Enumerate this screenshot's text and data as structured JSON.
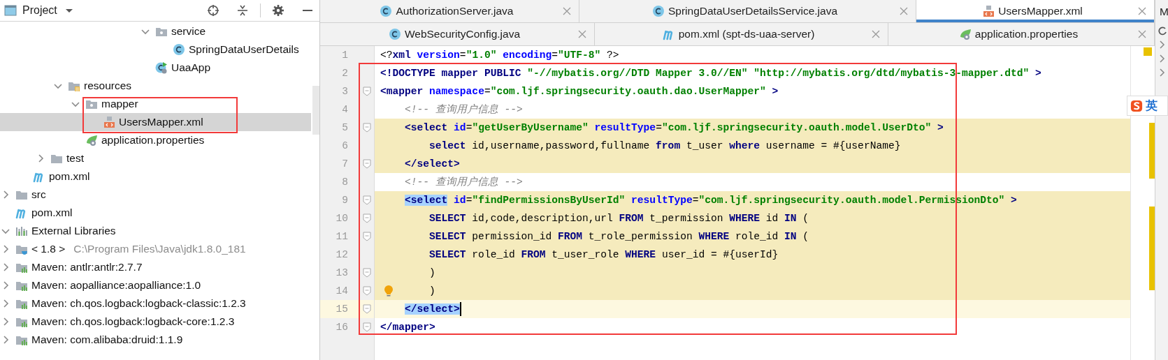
{
  "project_panel": {
    "title": "Project"
  },
  "tree": [
    {
      "children": [
        {
          "children": [
            {
              "children": [
                {
                  "children": [
                    {
                      "children": [
                        {
                          "children": [
                            {
                              "children": [
                                {
                                  "children": [
                                    {
                                      "children": [
                                        {
                                          "label": "service",
                                          "kind": "package",
                                          "expanded": true,
                                          "selected": false,
                                          "children": [
                                            {
                                              "label": "SpringDataUserDetails",
                                              "kind": "class",
                                              "selected": false
                                            }
                                          ]
                                        },
                                        {
                                          "label": "UaaApp",
                                          "kind": "boot-class",
                                          "selected": false
                                        }
                                      ]
                                    }
                                  ]
                                }
                              ]
                            }
                          ]
                        }
                      ]
                    },
                    {
                      "label": "resources",
                      "kind": "resources",
                      "expanded": true,
                      "selected": false,
                      "children": [
                        {
                          "label": "mapper",
                          "kind": "package",
                          "expanded": true,
                          "selected": false,
                          "children": [
                            {
                              "label": "UsersMapper.xml",
                              "kind": "xml",
                              "selected": true
                            }
                          ]
                        },
                        {
                          "label": "application.properties",
                          "kind": "properties",
                          "selected": false
                        }
                      ]
                    }
                  ]
                },
                {
                  "label": "test",
                  "kind": "folder",
                  "expanded": false,
                  "selected": false
                }
              ]
            },
            {
              "label": "pom.xml",
              "kind": "maven",
              "selected": false
            }
          ]
        },
        {
          "label": "src",
          "kind": "folder",
          "expanded": false,
          "selected": false
        },
        {
          "label": "pom.xml",
          "kind": "maven",
          "selected": false
        }
      ]
    },
    {
      "label": "External Libraries",
      "kind": "libraries",
      "expanded": true,
      "selected": false,
      "children": [
        {
          "label": "< 1.8 >",
          "secondary": "C:\\Program Files\\Java\\jdk1.8.0_181",
          "kind": "jdk",
          "expanded": false,
          "selected": false
        },
        {
          "label": "Maven: antlr:antlr:2.7.7",
          "kind": "library",
          "expanded": false,
          "selected": false
        },
        {
          "label": "Maven: aopalliance:aopalliance:1.0",
          "kind": "library",
          "expanded": false,
          "selected": false
        },
        {
          "label": "Maven: ch.qos.logback:logback-classic:1.2.3",
          "kind": "library",
          "expanded": false,
          "selected": false
        },
        {
          "label": "Maven: ch.qos.logback:logback-core:1.2.3",
          "kind": "library",
          "expanded": false,
          "selected": false
        },
        {
          "label": "Maven: com.alibaba:druid:1.1.9",
          "kind": "library",
          "expanded": false,
          "selected": false
        }
      ]
    }
  ],
  "tab_rows": [
    [
      {
        "label": "AuthorizationServer.java",
        "kind": "class",
        "selected": false
      },
      {
        "label": "SpringDataUserDetailsService.java",
        "kind": "class",
        "selected": false
      },
      {
        "label": "UsersMapper.xml",
        "kind": "xml",
        "selected": true
      }
    ],
    [
      {
        "label": "WebSecurityConfig.java",
        "kind": "class",
        "selected": false
      },
      {
        "label": "pom.xml (spt-ds-uaa-server)",
        "kind": "maven",
        "selected": false
      },
      {
        "label": "application.properties",
        "kind": "properties",
        "selected": false
      }
    ]
  ],
  "overflow_tab": {
    "label": "M"
  },
  "code_lines": [
    {
      "number": "1",
      "injected": false,
      "current": false,
      "fold": false,
      "bulb": false,
      "cursor": false,
      "tokens": [
        {
          "text": "<?",
          "kind": "plain"
        },
        {
          "text": "xml ",
          "kind": "tag"
        },
        {
          "text": "version",
          "kind": "attr"
        },
        {
          "text": "=",
          "kind": "plain"
        },
        {
          "text": "\"1.0\"",
          "kind": "string"
        },
        {
          "text": " encoding",
          "kind": "attr"
        },
        {
          "text": "=",
          "kind": "plain"
        },
        {
          "text": "\"UTF-8\"",
          "kind": "string"
        },
        {
          "text": " ?>",
          "kind": "plain"
        }
      ]
    },
    {
      "number": "2",
      "injected": false,
      "current": false,
      "fold": false,
      "bulb": false,
      "cursor": false,
      "tokens": [
        {
          "text": "<!DOCTYPE mapper PUBLIC ",
          "kind": "tag"
        },
        {
          "text": "\"-//mybatis.org//DTD Mapper 3.0//EN\" \"http://mybatis.org/dtd/mybatis-3-mapper.dtd\"",
          "kind": "string"
        },
        {
          "text": " >",
          "kind": "tag"
        }
      ]
    },
    {
      "number": "3",
      "injected": false,
      "current": false,
      "fold": true,
      "bulb": false,
      "cursor": false,
      "tokens": [
        {
          "text": "<mapper",
          "kind": "tag"
        },
        {
          "text": " namespace",
          "kind": "attr"
        },
        {
          "text": "=",
          "kind": "plain"
        },
        {
          "text": "\"com.ljf.springsecurity.oauth.dao.UserMapper\"",
          "kind": "string"
        },
        {
          "text": " >",
          "kind": "tag"
        }
      ]
    },
    {
      "number": "4",
      "injected": false,
      "current": false,
      "fold": false,
      "bulb": false,
      "cursor": false,
      "tokens": [
        {
          "text": "    <!-- 查询用户信息 -->",
          "kind": "comment"
        }
      ]
    },
    {
      "number": "5",
      "injected": true,
      "current": false,
      "fold": true,
      "bulb": false,
      "cursor": false,
      "tokens": [
        {
          "text": "    <select",
          "kind": "tag"
        },
        {
          "text": " id",
          "kind": "attr"
        },
        {
          "text": "=",
          "kind": "plain"
        },
        {
          "text": "\"getUserByUsername\"",
          "kind": "string"
        },
        {
          "text": " resultType",
          "kind": "attr"
        },
        {
          "text": "=",
          "kind": "plain"
        },
        {
          "text": "\"com.ljf.springsecurity.oauth.model.UserDto\"",
          "kind": "string"
        },
        {
          "text": " >",
          "kind": "tag"
        }
      ]
    },
    {
      "number": "6",
      "injected": true,
      "current": false,
      "fold": false,
      "bulb": false,
      "cursor": false,
      "tokens": [
        {
          "text": "        select",
          "kind": "keyword"
        },
        {
          "text": " id,username,password,fullname ",
          "kind": "plain"
        },
        {
          "text": "from",
          "kind": "keyword"
        },
        {
          "text": " t_user ",
          "kind": "plain"
        },
        {
          "text": "where",
          "kind": "keyword"
        },
        {
          "text": " username = #{userName}",
          "kind": "plain"
        }
      ]
    },
    {
      "number": "7",
      "injected": true,
      "current": false,
      "fold": true,
      "bulb": false,
      "cursor": false,
      "tokens": [
        {
          "text": "    </select>",
          "kind": "tag"
        }
      ]
    },
    {
      "number": "8",
      "injected": false,
      "current": false,
      "fold": false,
      "bulb": false,
      "cursor": false,
      "tokens": [
        {
          "text": "    <!-- 查询用户信息 -->",
          "kind": "comment"
        }
      ]
    },
    {
      "number": "9",
      "injected": true,
      "current": false,
      "fold": true,
      "bulb": false,
      "cursor": false,
      "tokens": [
        {
          "text": "    <select",
          "kind": "tag",
          "selected": true
        },
        {
          "text": " id",
          "kind": "attr"
        },
        {
          "text": "=",
          "kind": "plain"
        },
        {
          "text": "\"findPermissionsByUserId\"",
          "kind": "string"
        },
        {
          "text": " resultType",
          "kind": "attr"
        },
        {
          "text": "=",
          "kind": "plain"
        },
        {
          "text": "\"com.ljf.springsecurity.oauth.model.PermissionDto\"",
          "kind": "string"
        },
        {
          "text": " >",
          "kind": "tag"
        }
      ]
    },
    {
      "number": "10",
      "injected": true,
      "current": false,
      "fold": true,
      "bulb": false,
      "cursor": false,
      "tokens": [
        {
          "text": "        SELECT",
          "kind": "keyword"
        },
        {
          "text": " id,code,description,url ",
          "kind": "plain"
        },
        {
          "text": "FROM",
          "kind": "keyword"
        },
        {
          "text": " t_permission ",
          "kind": "plain"
        },
        {
          "text": "WHERE",
          "kind": "keyword"
        },
        {
          "text": " id ",
          "kind": "plain"
        },
        {
          "text": "IN",
          "kind": "keyword"
        },
        {
          "text": " (",
          "kind": "plain"
        }
      ]
    },
    {
      "number": "11",
      "injected": true,
      "current": false,
      "fold": true,
      "bulb": false,
      "cursor": false,
      "tokens": [
        {
          "text": "        SELECT",
          "kind": "keyword"
        },
        {
          "text": " permission_id ",
          "kind": "plain"
        },
        {
          "text": "FROM",
          "kind": "keyword"
        },
        {
          "text": " t_role_permission ",
          "kind": "plain"
        },
        {
          "text": "WHERE",
          "kind": "keyword"
        },
        {
          "text": " role_id ",
          "kind": "plain"
        },
        {
          "text": "IN",
          "kind": "keyword"
        },
        {
          "text": " (",
          "kind": "plain"
        }
      ]
    },
    {
      "number": "12",
      "injected": true,
      "current": false,
      "fold": false,
      "bulb": false,
      "cursor": false,
      "tokens": [
        {
          "text": "        SELECT",
          "kind": "keyword"
        },
        {
          "text": " role_id ",
          "kind": "plain"
        },
        {
          "text": "FROM",
          "kind": "keyword"
        },
        {
          "text": " t_user_role ",
          "kind": "plain"
        },
        {
          "text": "WHERE",
          "kind": "keyword"
        },
        {
          "text": " user_id = #{userId}",
          "kind": "plain"
        }
      ]
    },
    {
      "number": "13",
      "injected": true,
      "current": false,
      "fold": true,
      "bulb": false,
      "cursor": false,
      "tokens": [
        {
          "text": "        )",
          "kind": "plain"
        }
      ]
    },
    {
      "number": "14",
      "injected": true,
      "current": false,
      "fold": true,
      "bulb": true,
      "cursor": false,
      "tokens": [
        {
          "text": "        )",
          "kind": "plain"
        }
      ]
    },
    {
      "number": "15",
      "injected": false,
      "current": true,
      "fold": true,
      "bulb": false,
      "cursor": true,
      "tokens": [
        {
          "text": "    </select>",
          "kind": "tag",
          "selected": true
        }
      ]
    },
    {
      "number": "16",
      "injected": false,
      "current": false,
      "fold": true,
      "bulb": false,
      "cursor": false,
      "tokens": [
        {
          "text": "</mapper>",
          "kind": "tag"
        }
      ]
    }
  ],
  "ime_badge": {
    "label": "英"
  }
}
